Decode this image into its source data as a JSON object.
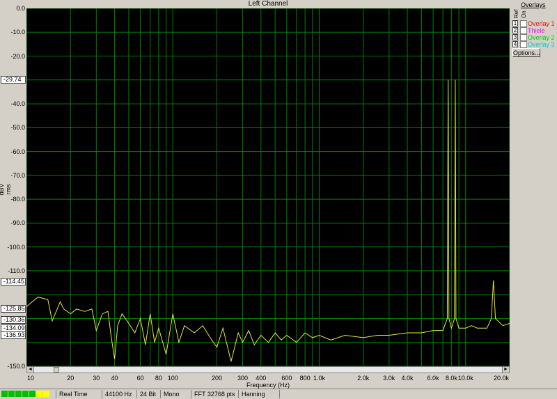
{
  "window": {
    "title": "Left Channel"
  },
  "y_axis": {
    "label": "dBV rms",
    "ticks": [
      "0.0",
      "-10.0",
      "-20.0",
      "-40.0",
      "-50.0",
      "-60.0",
      "-70.0",
      "-80.0",
      "-90.0",
      "-100.0",
      "-110.0",
      "-150.0"
    ],
    "tick_values": [
      0,
      -10,
      -20,
      -40,
      -50,
      -60,
      -70,
      -80,
      -90,
      -100,
      -110,
      -150
    ],
    "markers": [
      "-29.74",
      "-114.45",
      "-125.85",
      "-130.36",
      "-134.09",
      "-136.93"
    ],
    "marker_values": [
      -29.74,
      -114.45,
      -125.85,
      -130.36,
      -134.09,
      -136.93
    ]
  },
  "x_axis": {
    "label": "Frequency (Hz)",
    "ticks": [
      "10",
      "20",
      "30",
      "40",
      "60",
      "80",
      "100",
      "200",
      "300",
      "400",
      "600",
      "800",
      "1.0k",
      "2.0k",
      "3.0k",
      "4.0k",
      "6.0k",
      "8.0k",
      "10.0k",
      "20.0k"
    ],
    "tick_values": [
      10,
      20,
      30,
      40,
      60,
      80,
      100,
      200,
      300,
      400,
      600,
      800,
      1000,
      2000,
      3000,
      4000,
      6000,
      8000,
      10000,
      20000
    ]
  },
  "overlays": {
    "title": "Overlays",
    "col_ref": "Ref",
    "col_on": "On",
    "options_label": "Options...",
    "items": [
      {
        "num": "1",
        "label": "Overlay 1",
        "color": "#ff0000"
      },
      {
        "num": "2",
        "label": "Thiele",
        "color": "#ff00ff"
      },
      {
        "num": "3",
        "label": "Overlay 2",
        "color": "#00cc00"
      },
      {
        "num": "4",
        "label": "Overlay 3",
        "color": "#00cccc"
      }
    ]
  },
  "status": {
    "mode": "Real Time",
    "sample_rate": "44100 Hz",
    "bit_depth": "24 Bit",
    "channels": "Mono",
    "fft": "FFT 32768 pts",
    "window": "Hanning"
  },
  "colors": {
    "trace": "#e8e840",
    "grid": "#008000",
    "background": "#000000"
  },
  "chart_data": {
    "type": "line",
    "title": "Left Channel",
    "xlabel": "Frequency (Hz)",
    "ylabel": "dBV rms",
    "xscale": "log",
    "xlim": [
      10,
      20000
    ],
    "ylim": [
      -150,
      0
    ],
    "grid": true,
    "series": [
      {
        "x": [
          10,
          12,
          14,
          15,
          17,
          18,
          20,
          22,
          25,
          28,
          30,
          33,
          36,
          38,
          40,
          42,
          45,
          50,
          55,
          60,
          65,
          70,
          75,
          80,
          90,
          100,
          110,
          120,
          140,
          160,
          180,
          200,
          220,
          250,
          280,
          300,
          330,
          360,
          400,
          450,
          500,
          550,
          600,
          700,
          800,
          900,
          1000,
          1200,
          1500,
          2000,
          2500,
          3000,
          4000,
          5000,
          6000,
          7000,
          7500,
          7600,
          7700,
          8000,
          8400,
          8500,
          8600,
          9000,
          10000,
          11000,
          12000,
          14000,
          15000,
          15500,
          16000,
          18000,
          20000
        ],
        "values": [
          -125,
          -121,
          -122,
          -131,
          -123,
          -126,
          -128,
          -126,
          -127,
          -126,
          -135,
          -128,
          -127,
          -138,
          -147,
          -133,
          -128,
          -132,
          -136,
          -130,
          -141,
          -128,
          -140,
          -134,
          -145,
          -128,
          -140,
          -133,
          -136,
          -133,
          -138,
          -142,
          -134,
          -148,
          -136,
          -140,
          -135,
          -141,
          -137,
          -140,
          -136,
          -139,
          -137,
          -140,
          -136,
          -138,
          -137,
          -139,
          -137,
          -138,
          -137,
          -137,
          -136,
          -136,
          -135,
          -135,
          -130,
          -30,
          -130,
          -134,
          -130,
          -30,
          -130,
          -134,
          -134,
          -133,
          -134,
          -134,
          -130,
          -114,
          -130,
          -133,
          -132
        ]
      }
    ]
  }
}
